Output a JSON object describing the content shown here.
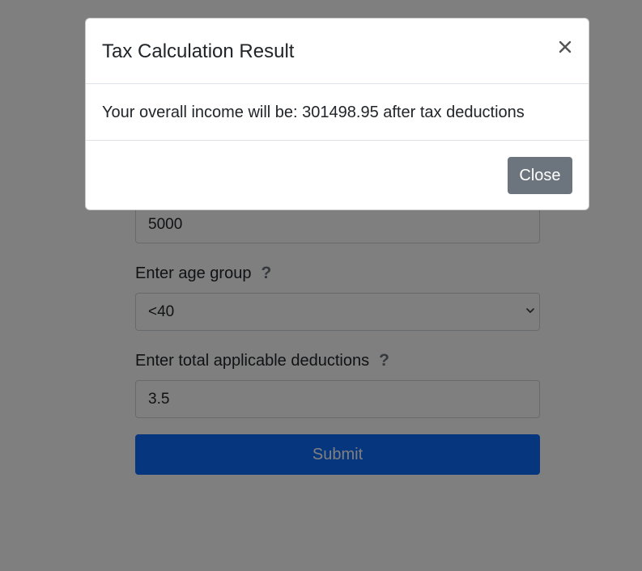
{
  "form": {
    "hidden_field_value": "5000",
    "age_group": {
      "label": "Enter age group",
      "help_icon": "?",
      "selected": "<40"
    },
    "deductions": {
      "label": "Enter total applicable deductions",
      "help_icon": "?",
      "value": "3.5"
    },
    "submit_label": "Submit"
  },
  "modal": {
    "title": "Tax Calculation Result",
    "message": "Your overall income will be: 301498.95 after tax deductions",
    "close_button_label": "Close",
    "close_icon": "close-icon"
  },
  "colors": {
    "primary": "#0d6efd",
    "secondary": "#6c757d",
    "backdrop": "rgba(0,0,0,0.5)"
  }
}
